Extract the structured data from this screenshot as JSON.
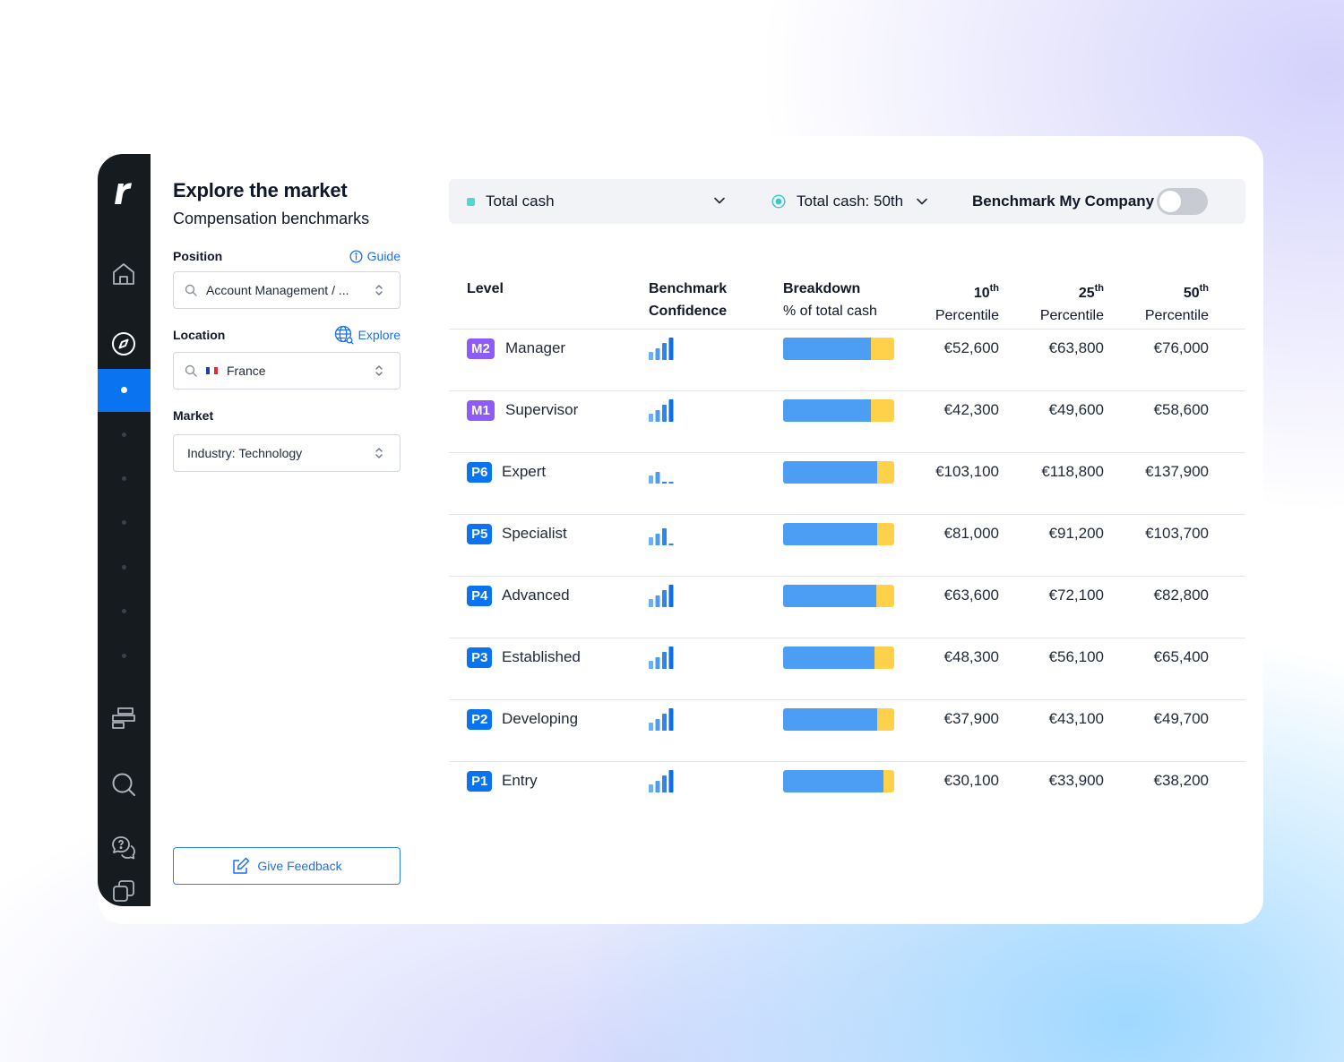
{
  "panel": {
    "title": "Explore the market",
    "subtitle": "Compensation benchmarks",
    "position": {
      "label": "Position",
      "link": "Guide",
      "value": "Account Management / ..."
    },
    "location": {
      "label": "Location",
      "link": "Explore",
      "value": "France"
    },
    "market": {
      "label": "Market",
      "value": "Industry: Technology"
    },
    "feedback_label": "Give Feedback"
  },
  "toolbar": {
    "metric": "Total cash",
    "percentile": "Total cash: 50th",
    "benchmark_label": "Benchmark My Company",
    "benchmark_on": false
  },
  "colors": {
    "accent": "#1d6ff2",
    "manager_badge": "#8b5cf6",
    "professional_badge": "#0a74f0",
    "base_bar": "#4b9ef3",
    "variable_bar": "#ffd14a",
    "metric_swatch": "#4fd6d6"
  },
  "table": {
    "headers": {
      "level": "Level",
      "confidence_1": "Benchmark",
      "confidence_2": "Confidence",
      "breakdown_1": "Breakdown",
      "breakdown_2": "% of total cash",
      "p10_num": "10",
      "p25_num": "25",
      "p50_num": "50",
      "th": "th",
      "percentile": "Percentile"
    },
    "rows": [
      {
        "code": "M2",
        "role": "Manager",
        "type": "manager",
        "confidence": 4,
        "base_share": 0.79,
        "p10": "€52,600",
        "p25": "€63,800",
        "p50": "€76,000"
      },
      {
        "code": "M1",
        "role": "Supervisor",
        "type": "manager",
        "confidence": 4,
        "base_share": 0.79,
        "p10": "€42,300",
        "p25": "€49,600",
        "p50": "€58,600"
      },
      {
        "code": "P6",
        "role": "Expert",
        "type": "professional",
        "confidence": 2,
        "base_share": 0.85,
        "p10": "€103,100",
        "p25": "€118,800",
        "p50": "€137,900"
      },
      {
        "code": "P5",
        "role": "Specialist",
        "type": "professional",
        "confidence": 3,
        "base_share": 0.85,
        "p10": "€81,000",
        "p25": "€91,200",
        "p50": "€103,700"
      },
      {
        "code": "P4",
        "role": "Advanced",
        "type": "professional",
        "confidence": 4,
        "base_share": 0.84,
        "p10": "€63,600",
        "p25": "€72,100",
        "p50": "€82,800"
      },
      {
        "code": "P3",
        "role": "Established",
        "type": "professional",
        "confidence": 4,
        "base_share": 0.82,
        "p10": "€48,300",
        "p25": "€56,100",
        "p50": "€65,400"
      },
      {
        "code": "P2",
        "role": "Developing",
        "type": "professional",
        "confidence": 4,
        "base_share": 0.85,
        "p10": "€37,900",
        "p25": "€43,100",
        "p50": "€49,700"
      },
      {
        "code": "P1",
        "role": "Entry",
        "type": "professional",
        "confidence": 4,
        "base_share": 0.9,
        "p10": "€30,100",
        "p25": "€33,900",
        "p50": "€38,200"
      }
    ]
  }
}
